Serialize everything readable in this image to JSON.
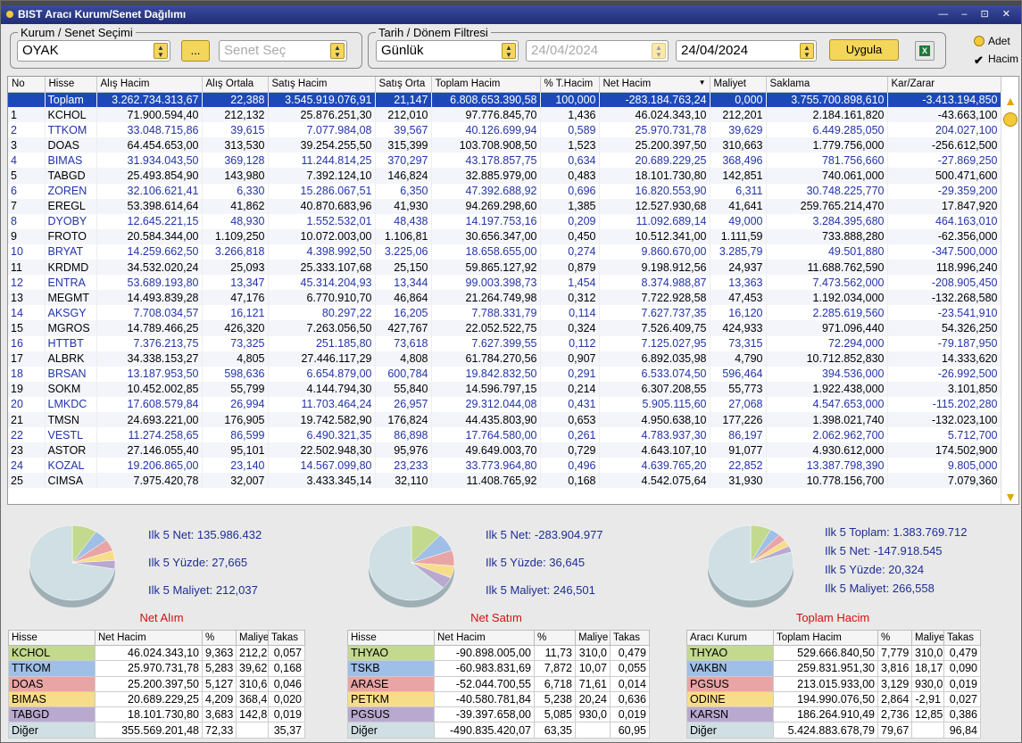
{
  "window": {
    "title": "BIST Aracı Kurum/Senet Dağılımı",
    "controls": "— – ⊡ ✕"
  },
  "filters": {
    "kurum_legend": "Kurum / Senet Seçimi",
    "kurum_value": "OYAK",
    "dots_label": "...",
    "senet_placeholder": "Senet Seç",
    "tarih_legend": "Tarih / Dönem Filtresi",
    "period_value": "Günlük",
    "date_from": "24/04/2024",
    "date_to": "24/04/2024",
    "apply_label": "Uygula",
    "excel_label": "X",
    "radio_adet": "Adet",
    "check_hacim": "Hacim"
  },
  "colors": {
    "accent": "#1d49b8",
    "stat": "#1e2d96",
    "title": "#d21010",
    "button": "#f4d65a"
  },
  "columns": [
    "No",
    "Hisse",
    "Alış Hacim",
    "Alış Ortala",
    "Satış Hacim",
    "Satış Orta",
    "Toplam Hacim",
    "% T.Hacim",
    "Net Hacim",
    "Maliyet",
    "Saklama",
    "Kar/Zarar"
  ],
  "rows": [
    [
      "",
      "Toplam",
      "3.262.734.313,67",
      "22,388",
      "3.545.919.076,91",
      "21,147",
      "6.808.653.390,58",
      "100,000",
      "-283.184.763,24",
      "0,000",
      "3.755.700.898,610",
      "-3.413.194,850"
    ],
    [
      "1",
      "KCHOL",
      "71.900.594,40",
      "212,132",
      "25.876.251,30",
      "212,010",
      "97.776.845,70",
      "1,436",
      "46.024.343,10",
      "212,201",
      "2.184.161,820",
      "-43.663,100"
    ],
    [
      "2",
      "TTKOM",
      "33.048.715,86",
      "39,615",
      "7.077.984,08",
      "39,567",
      "40.126.699,94",
      "0,589",
      "25.970.731,78",
      "39,629",
      "6.449.285,050",
      "204.027,100"
    ],
    [
      "3",
      "DOAS",
      "64.454.653,00",
      "313,530",
      "39.254.255,50",
      "315,399",
      "103.708.908,50",
      "1,523",
      "25.200.397,50",
      "310,663",
      "1.779.756,000",
      "-256.612,500"
    ],
    [
      "4",
      "BIMAS",
      "31.934.043,50",
      "369,128",
      "11.244.814,25",
      "370,297",
      "43.178.857,75",
      "0,634",
      "20.689.229,25",
      "368,496",
      "781.756,660",
      "-27.869,250"
    ],
    [
      "5",
      "TABGD",
      "25.493.854,90",
      "143,980",
      "7.392.124,10",
      "146,824",
      "32.885.979,00",
      "0,483",
      "18.101.730,80",
      "142,851",
      "740.061,000",
      "500.471,600"
    ],
    [
      "6",
      "ZOREN",
      "32.106.621,41",
      "6,330",
      "15.286.067,51",
      "6,350",
      "47.392.688,92",
      "0,696",
      "16.820.553,90",
      "6,311",
      "30.748.225,770",
      "-29.359,200"
    ],
    [
      "7",
      "EREGL",
      "53.398.614,64",
      "41,862",
      "40.870.683,96",
      "41,930",
      "94.269.298,60",
      "1,385",
      "12.527.930,68",
      "41,641",
      "259.765.214,470",
      "17.847,920"
    ],
    [
      "8",
      "DYOBY",
      "12.645.221,15",
      "48,930",
      "1.552.532,01",
      "48,438",
      "14.197.753,16",
      "0,209",
      "11.092.689,14",
      "49,000",
      "3.284.395,680",
      "464.163,010"
    ],
    [
      "9",
      "FROTO",
      "20.584.344,00",
      "1.109,250",
      "10.072.003,00",
      "1.106,81",
      "30.656.347,00",
      "0,450",
      "10.512.341,00",
      "1.111,59",
      "733.888,280",
      "-62.356,000"
    ],
    [
      "10",
      "BRYAT",
      "14.259.662,50",
      "3.266,818",
      "4.398.992,50",
      "3.225,06",
      "18.658.655,00",
      "0,274",
      "9.860.670,00",
      "3.285,79",
      "49.501,880",
      "-347.500,000"
    ],
    [
      "11",
      "KRDMD",
      "34.532.020,24",
      "25,093",
      "25.333.107,68",
      "25,150",
      "59.865.127,92",
      "0,879",
      "9.198.912,56",
      "24,937",
      "11.688.762,590",
      "118.996,240"
    ],
    [
      "12",
      "ENTRA",
      "53.689.193,80",
      "13,347",
      "45.314.204,93",
      "13,344",
      "99.003.398,73",
      "1,454",
      "8.374.988,87",
      "13,363",
      "7.473.562,000",
      "-208.905,450"
    ],
    [
      "13",
      "MEGMT",
      "14.493.839,28",
      "47,176",
      "6.770.910,70",
      "46,864",
      "21.264.749,98",
      "0,312",
      "7.722.928,58",
      "47,453",
      "1.192.034,000",
      "-132.268,580"
    ],
    [
      "14",
      "AKSGY",
      "7.708.034,57",
      "16,121",
      "80.297,22",
      "16,205",
      "7.788.331,79",
      "0,114",
      "7.627.737,35",
      "16,120",
      "2.285.619,560",
      "-23.541,910"
    ],
    [
      "15",
      "MGROS",
      "14.789.466,25",
      "426,320",
      "7.263.056,50",
      "427,767",
      "22.052.522,75",
      "0,324",
      "7.526.409,75",
      "424,933",
      "971.096,440",
      "54.326,250"
    ],
    [
      "16",
      "HTTBT",
      "7.376.213,75",
      "73,325",
      "251.185,80",
      "73,618",
      "7.627.399,55",
      "0,112",
      "7.125.027,95",
      "73,315",
      "72.294,000",
      "-79.187,950"
    ],
    [
      "17",
      "ALBRK",
      "34.338.153,27",
      "4,805",
      "27.446.117,29",
      "4,808",
      "61.784.270,56",
      "0,907",
      "6.892.035,98",
      "4,790",
      "10.712.852,830",
      "14.333,620"
    ],
    [
      "18",
      "BRSAN",
      "13.187.953,50",
      "598,636",
      "6.654.879,00",
      "600,784",
      "19.842.832,50",
      "0,291",
      "6.533.074,50",
      "596,464",
      "394.536,000",
      "-26.992,500"
    ],
    [
      "19",
      "SOKM",
      "10.452.002,85",
      "55,799",
      "4.144.794,30",
      "55,840",
      "14.596.797,15",
      "0,214",
      "6.307.208,55",
      "55,773",
      "1.922.438,000",
      "3.101,850"
    ],
    [
      "20",
      "LMKDC",
      "17.608.579,84",
      "26,994",
      "11.703.464,24",
      "26,957",
      "29.312.044,08",
      "0,431",
      "5.905.115,60",
      "27,068",
      "4.547.653,000",
      "-115.202,280"
    ],
    [
      "21",
      "TMSN",
      "24.693.221,00",
      "176,905",
      "19.742.582,90",
      "176,824",
      "44.435.803,90",
      "0,653",
      "4.950.638,10",
      "177,226",
      "1.398.021,740",
      "-132.023,100"
    ],
    [
      "22",
      "VESTL",
      "11.274.258,65",
      "86,599",
      "6.490.321,35",
      "86,898",
      "17.764.580,00",
      "0,261",
      "4.783.937,30",
      "86,197",
      "2.062.962,700",
      "5.712,700"
    ],
    [
      "23",
      "ASTOR",
      "27.146.055,40",
      "95,101",
      "22.502.948,30",
      "95,976",
      "49.649.003,70",
      "0,729",
      "4.643.107,10",
      "91,077",
      "4.930.612,000",
      "174.502,900"
    ],
    [
      "24",
      "KOZAL",
      "19.206.865,00",
      "23,140",
      "14.567.099,80",
      "23,233",
      "33.773.964,80",
      "0,496",
      "4.639.765,20",
      "22,852",
      "13.387.798,390",
      "9.805,000"
    ],
    [
      "25",
      "CIMSA",
      "7.975.420,78",
      "32,007",
      "3.433.345,14",
      "32,110",
      "11.408.765,92",
      "0,168",
      "4.542.075,64",
      "31,930",
      "10.778.156,700",
      "7.079,360"
    ]
  ],
  "panels": [
    {
      "title": "Net Alım",
      "stats": [
        "Ilk 5 Net: 135.986.432",
        "Ilk 5 Yüzde: 27,665",
        "Ilk 5 Maliyet: 212,037"
      ],
      "pie": [
        9.363,
        5.283,
        5.127,
        4.209,
        3.683,
        72.33
      ],
      "headers": [
        "Hisse",
        "Net Hacim",
        "%",
        "Maliye",
        "Takas"
      ],
      "rows": [
        [
          "KCHOL",
          "46.024.343,10",
          "9,363",
          "212,2",
          "0,057"
        ],
        [
          "TTKOM",
          "25.970.731,78",
          "5,283",
          "39,62",
          "0,168"
        ],
        [
          "DOAS",
          "25.200.397,50",
          "5,127",
          "310,6",
          "0,046"
        ],
        [
          "BIMAS",
          "20.689.229,25",
          "4,209",
          "368,4",
          "0,020"
        ],
        [
          "TABGD",
          "18.101.730,80",
          "3,683",
          "142,8",
          "0,019"
        ],
        [
          "Diğer",
          "355.569.201,48",
          "72,33",
          "",
          "35,37"
        ]
      ]
    },
    {
      "title": "Net Satım",
      "stats": [
        "Ilk 5 Net: -283.904.977",
        "Ilk 5 Yüzde: 36,645",
        "Ilk 5 Maliyet: 246,501"
      ],
      "pie": [
        11.73,
        7.872,
        6.718,
        5.238,
        5.085,
        63.35
      ],
      "headers": [
        "Hisse",
        "Net Hacim",
        "%",
        "Maliye",
        "Takas"
      ],
      "rows": [
        [
          "THYAO",
          "-90.898.005,00",
          "11,73",
          "310,0",
          "0,479"
        ],
        [
          "TSKB",
          "-60.983.831,69",
          "7,872",
          "10,07",
          "0,055"
        ],
        [
          "ARASE",
          "-52.044.700,55",
          "6,718",
          "71,61",
          "0,014"
        ],
        [
          "PETKM",
          "-40.580.781,84",
          "5,238",
          "20,24",
          "0,636"
        ],
        [
          "PGSUS",
          "-39.397.658,00",
          "5,085",
          "930,0",
          "0,019"
        ],
        [
          "Diğer",
          "-490.835.420,07",
          "63,35",
          "",
          "60,95"
        ]
      ]
    },
    {
      "title": "Toplam Hacim",
      "stats": [
        "Ilk 5 Toplam: 1.383.769.712",
        "Ilk 5 Net: -147.918.545",
        "Ilk 5 Yüzde: 20,324",
        "Ilk 5 Maliyet: 266,558"
      ],
      "pie": [
        7.779,
        3.816,
        3.129,
        2.864,
        2.736,
        79.67
      ],
      "headers": [
        "Aracı Kurum",
        "Toplam Hacim",
        "%",
        "Maliye",
        "Takas"
      ],
      "rows": [
        [
          "THYAO",
          "529.666.840,50",
          "7,779",
          "310,0",
          "0,479"
        ],
        [
          "VAKBN",
          "259.831.951,30",
          "3,816",
          "18,17",
          "0,090"
        ],
        [
          "PGSUS",
          "213.015.933,00",
          "3,129",
          "930,0",
          "0,019"
        ],
        [
          "ODINE",
          "194.990.076,50",
          "2,864",
          "-2,91",
          "0,027"
        ],
        [
          "KARSN",
          "186.264.910,49",
          "2,736",
          "12,85",
          "0,386"
        ],
        [
          "Diğer",
          "5.424.883.678,79",
          "79,67",
          "",
          "96,84"
        ]
      ]
    }
  ],
  "row_colors": [
    "#c3d98e",
    "#9fbfe6",
    "#e9a5a5",
    "#f6dd8a",
    "#b9a9cf",
    "#cfdfe3"
  ]
}
